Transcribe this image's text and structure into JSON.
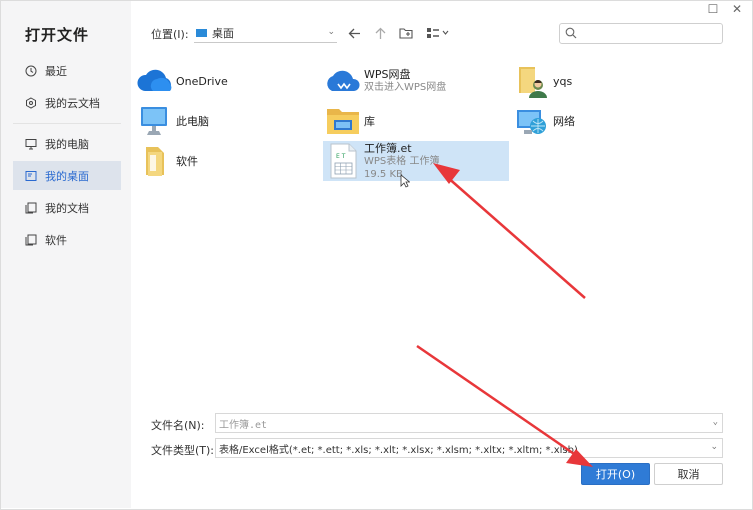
{
  "dialog": {
    "title": "打开文件"
  },
  "sidebar": {
    "items": [
      {
        "label": "最近",
        "icon": "clock-icon"
      },
      {
        "label": "我的云文档",
        "icon": "cloud-doc-icon"
      },
      {
        "label": "我的电脑",
        "icon": "computer-icon"
      },
      {
        "label": "我的桌面",
        "icon": "desktop-icon",
        "active": true
      },
      {
        "label": "我的文档",
        "icon": "documents-icon"
      },
      {
        "label": "软件",
        "icon": "folder-icon"
      }
    ]
  },
  "toolbar": {
    "location_label": "位置(I):",
    "location_value": "桌面"
  },
  "files": [
    {
      "name": "OneDrive",
      "icon": "onedrive-icon"
    },
    {
      "name": "WPS网盘",
      "sub": "双击进入WPS网盘",
      "icon": "wps-cloud-icon"
    },
    {
      "name": "yqs",
      "icon": "user-folder-icon"
    },
    {
      "name": "此电脑",
      "icon": "computer-icon"
    },
    {
      "name": "库",
      "icon": "library-icon"
    },
    {
      "name": "网络",
      "icon": "network-icon"
    },
    {
      "name": "软件",
      "icon": "folder-icon"
    },
    {
      "name": "工作簿.et",
      "sub": "WPS表格 工作簿",
      "size": "19.5 KB",
      "icon": "et-file-icon",
      "selected": true
    }
  ],
  "footer": {
    "filename_label": "文件名(N):",
    "filename_value": "工作簿.et",
    "filetype_label": "文件类型(T):",
    "filetype_value": "表格/Excel格式(*.et; *.ett; *.xls; *.xlt; *.xlsx; *.xlsm; *.xltx; *.xltm; *.xlsb)",
    "open_button": "打开(O)",
    "cancel_button": "取消"
  },
  "colors": {
    "accent": "#2f7bd6",
    "selection": "#cfe4f7",
    "annotation_arrow": "#e8373a"
  }
}
